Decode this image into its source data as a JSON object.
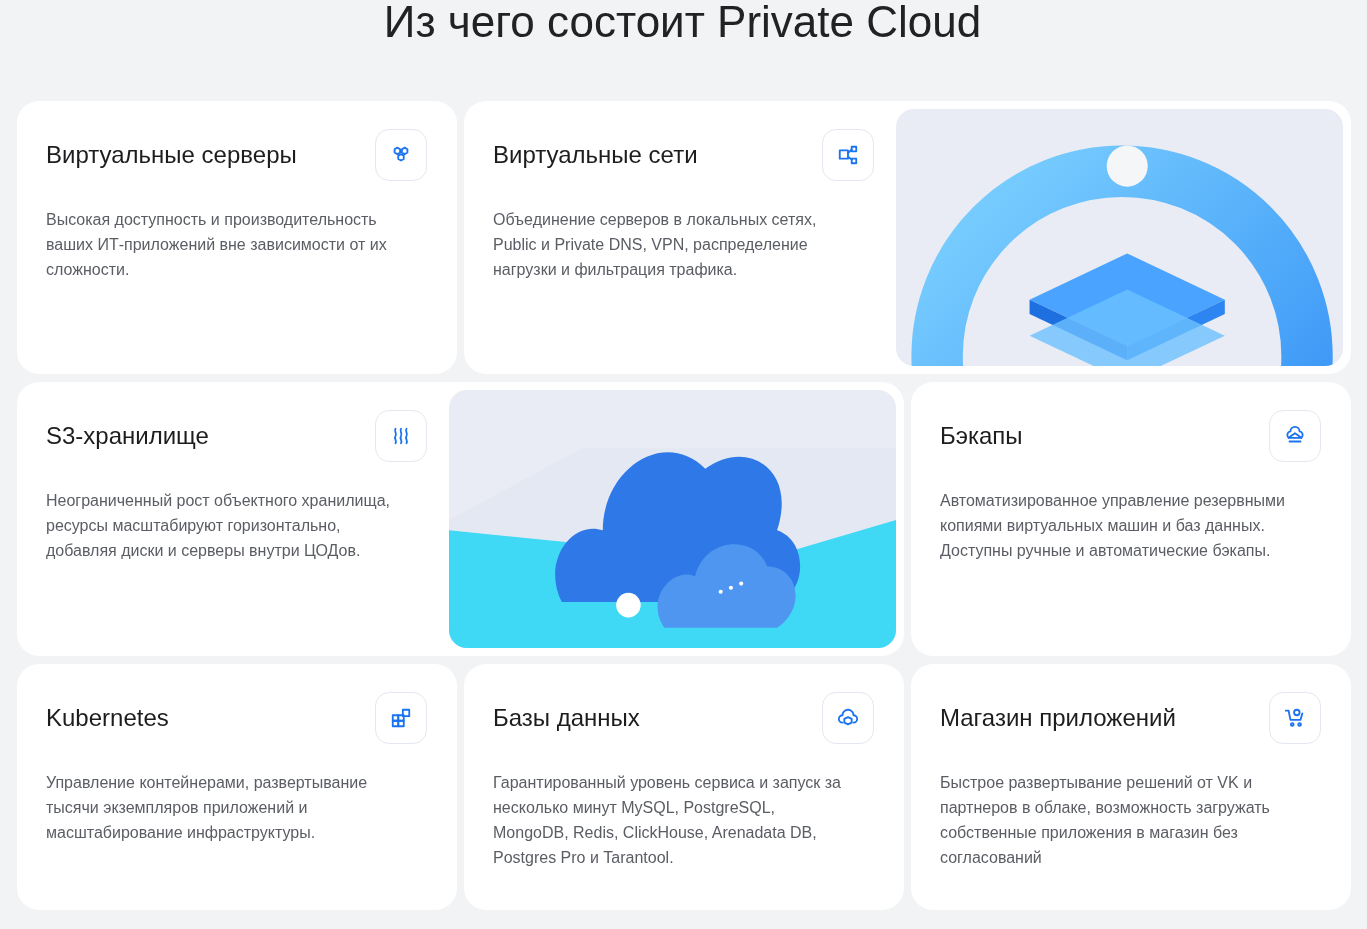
{
  "heading": "Из чего состоит Private Cloud",
  "cards": [
    {
      "kind": "plain",
      "title": "Виртуальные серверы",
      "description": "Высокая доступность и производительность ваших ИТ-приложений вне зависимости от их сложности."
    },
    {
      "kind": "image_right",
      "title": "Виртуальные сети",
      "description": "Объединение серверов в локальных сетях, Public и Private DNS, VPN, распределение нагрузки и фильтрация трафика."
    },
    {
      "kind": "image_right",
      "title": "S3-хранилище",
      "description": "Неограниченный рост объектного хранилища, ресурсы масштабируют горизонтально, добавляя диски и серверы внутри ЦОДов."
    },
    {
      "kind": "plain",
      "title": "Бэкапы",
      "description": "Автоматизированное управление резервными копиями виртуальных машин и баз данных. Доступны ручные и автоматические бэкапы."
    },
    {
      "kind": "plain",
      "title": "Kubernetes",
      "description": "Управление контейнерами, развертывание тысячи экземпляров приложений и масштабирование инфраструктуры."
    },
    {
      "kind": "plain",
      "title": "Базы данных",
      "description": "Гарантированный уровень сервиса и запуск за несколько минут MySQL, PostgreSQL, MongoDB, Redis, ClickHouse, Arenadata DB, Postgres Pro и Tarantool."
    },
    {
      "kind": "plain",
      "title": "Магазин приложений",
      "description": "Быстрое развертывание решений от VK и партнеров в облаке, возможность загружать собственные приложения в магазин без согласований"
    }
  ]
}
